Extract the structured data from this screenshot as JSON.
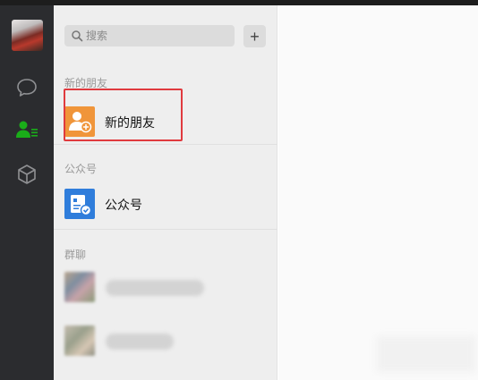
{
  "sidebar": {
    "nav": [
      {
        "icon": "chat-icon"
      },
      {
        "icon": "contacts-icon",
        "active_color": "#1aad19"
      },
      {
        "icon": "cube-icon"
      }
    ]
  },
  "search": {
    "placeholder": "搜索",
    "add_label": "+"
  },
  "sections": [
    {
      "label": "新的朋友",
      "item_label": "新的朋友",
      "icon": "new-friend-icon",
      "icon_color": "#f0953a"
    },
    {
      "label": "公众号",
      "item_label": "公众号",
      "icon": "official-account-icon",
      "icon_color": "#2f7ddb"
    },
    {
      "label": "群聊"
    }
  ],
  "colors": {
    "highlight": "#e03a3e"
  }
}
